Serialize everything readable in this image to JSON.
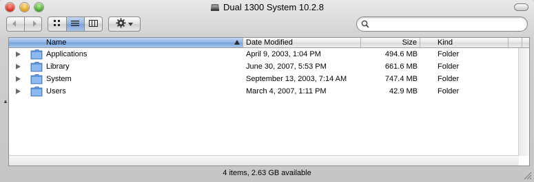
{
  "window": {
    "title": "Dual 1300 System 10.2.8"
  },
  "toolbar": {
    "back_icon": "back-arrow-icon",
    "forward_icon": "forward-arrow-icon",
    "view_modes": [
      "icon-view-icon",
      "list-view-icon",
      "column-view-icon"
    ],
    "active_view": "list",
    "action_icon": "gear-icon",
    "search": {
      "placeholder": "",
      "value": ""
    }
  },
  "list": {
    "columns": {
      "name": "Name",
      "date": "Date Modified",
      "size": "Size",
      "kind": "Kind"
    },
    "sorted_by": "name",
    "rows": [
      {
        "name": "Applications",
        "date": "April 9, 2003, 1:04 PM",
        "size": "494.6 MB",
        "kind": "Folder"
      },
      {
        "name": "Library",
        "date": "June 30, 2007, 5:53 PM",
        "size": "661.6 MB",
        "kind": "Folder"
      },
      {
        "name": "System",
        "date": "September 13, 2003, 7:14 AM",
        "size": "747.4 MB",
        "kind": "Folder"
      },
      {
        "name": "Users",
        "date": "March 4, 2007, 1:11 PM",
        "size": "42.9 MB",
        "kind": "Folder"
      }
    ]
  },
  "status": {
    "text": "4 items, 2.63 GB available"
  },
  "colors": {
    "selection_blue": "#8cb3e7",
    "folder_blue": "#6fa8e8"
  }
}
